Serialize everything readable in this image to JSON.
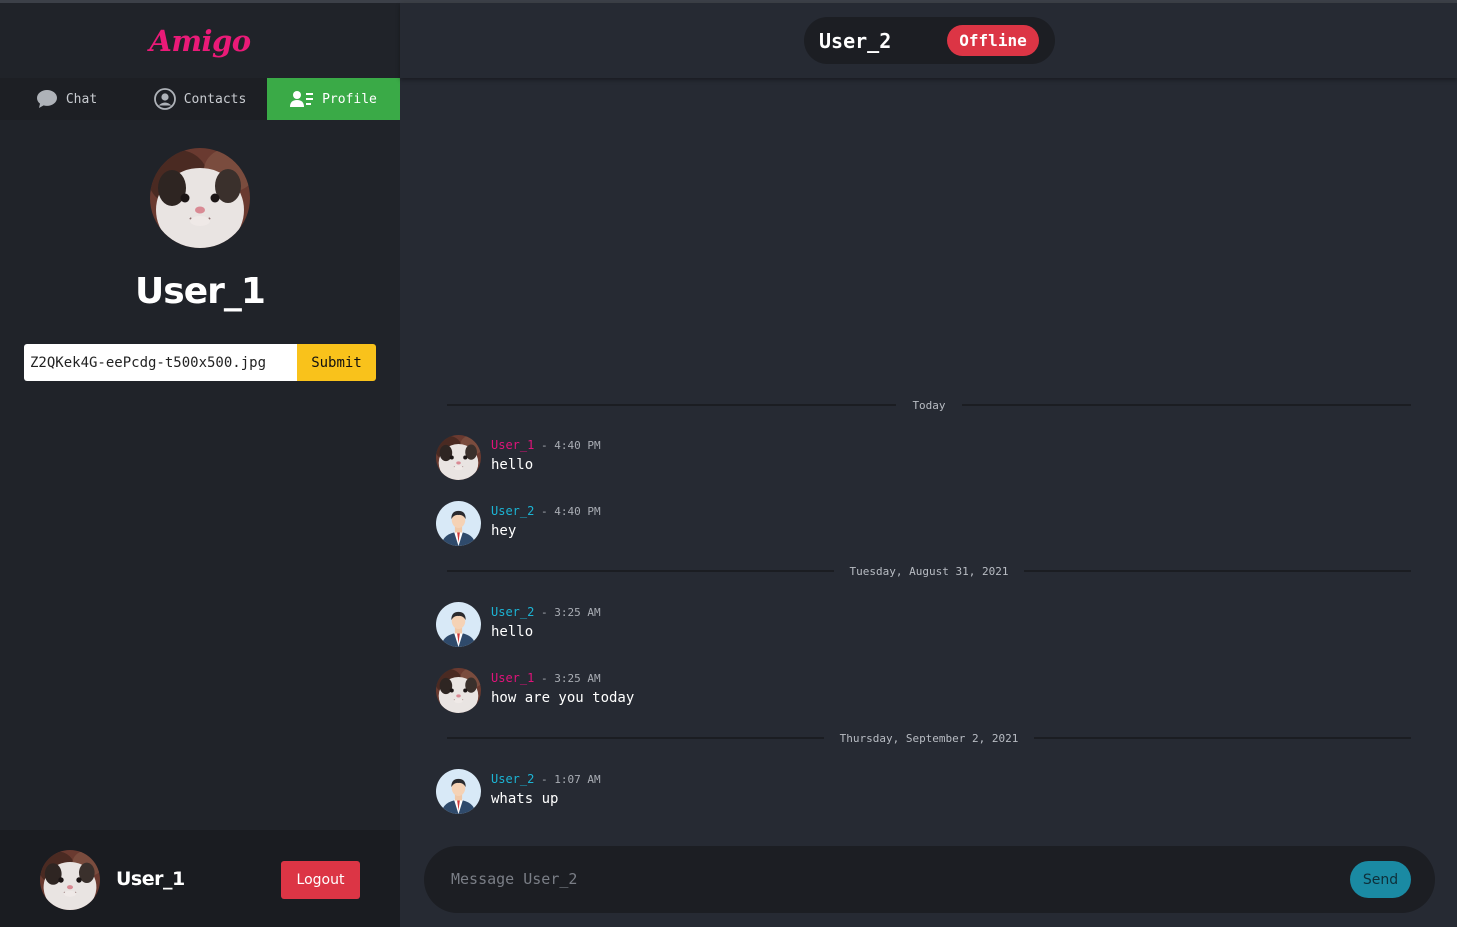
{
  "app": {
    "brand": "Amigo"
  },
  "tabs": [
    {
      "label": "Chat",
      "icon": "chat-bubble-icon",
      "active": false
    },
    {
      "label": "Contacts",
      "icon": "user-circle-icon",
      "active": false
    },
    {
      "label": "Profile",
      "icon": "profile-card-icon",
      "active": true
    }
  ],
  "profile": {
    "username": "User_1",
    "avatar": "cat-photo",
    "file_value": "Z2QKek4G-eePcdg-t500x500.jpg",
    "submit_label": "Submit"
  },
  "footer": {
    "username": "User_1",
    "logout_label": "Logout"
  },
  "header": {
    "contact_name": "User_2",
    "status": "Offline",
    "status_color": "#dc3545"
  },
  "dividers": [
    "Today",
    "Tuesday, August 31, 2021",
    "Thursday, September 2, 2021"
  ],
  "messages": [
    {
      "author": "User_1",
      "time": "4:40 PM",
      "text": "hello",
      "avatar": "cat-photo"
    },
    {
      "author": "User_2",
      "time": "4:40 PM",
      "text": "hey",
      "avatar": "businessman-avatar"
    },
    {
      "author": "User_2",
      "time": "3:25 AM",
      "text": "hello",
      "avatar": "businessman-avatar"
    },
    {
      "author": "User_1",
      "time": "3:25 AM",
      "text": "how are you today",
      "avatar": "cat-photo"
    },
    {
      "author": "User_2",
      "time": "1:07 AM",
      "text": "whats up",
      "avatar": "businessman-avatar"
    }
  ],
  "composer": {
    "placeholder": "Message User_2",
    "send_label": "Send"
  },
  "colors": {
    "brand": "#ea1a78",
    "user1": "#e0137a",
    "user2": "#1cb4d4",
    "active_tab": "#3aaa47",
    "submit": "#f9c21b",
    "logout": "#dc3545",
    "send": "#1a8aa3"
  }
}
